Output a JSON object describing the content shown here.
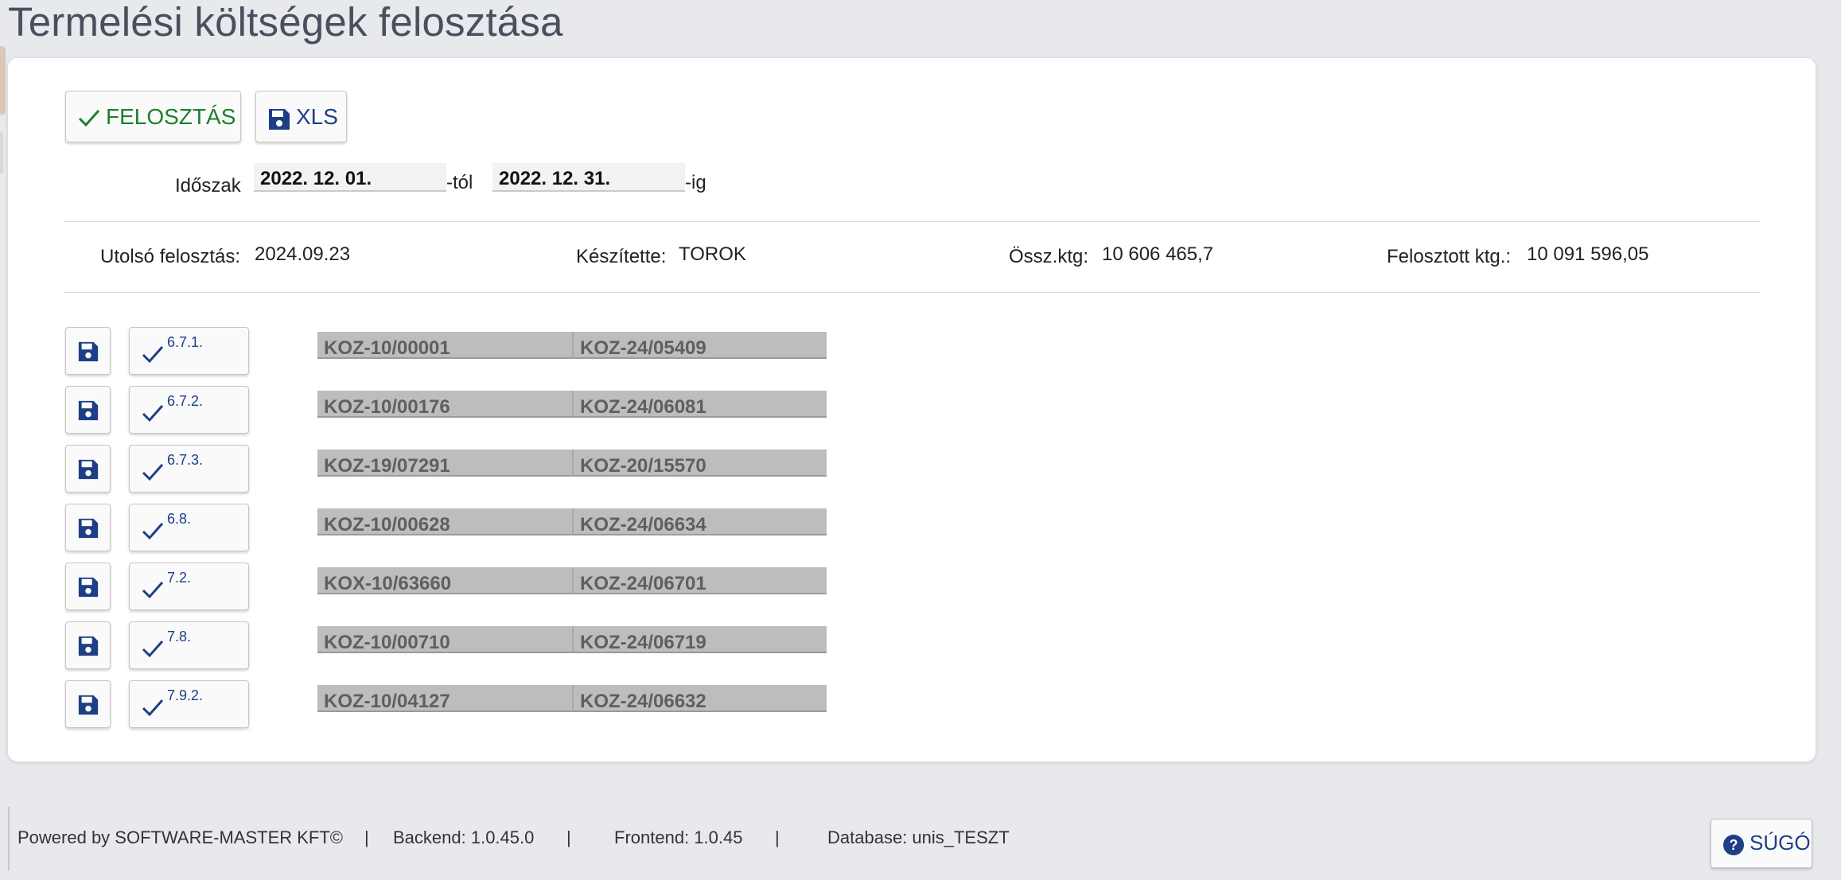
{
  "page": {
    "title": "Termelési költségek felosztása"
  },
  "toolbar": {
    "felosztas_label": "FELOSZTÁS",
    "xls_label": "XLS"
  },
  "period": {
    "label": "Időszak",
    "from_value": "2022. 12. 01.",
    "from_suffix": "-tól",
    "to_value": "2022. 12. 31.",
    "to_suffix": "-ig"
  },
  "summary": {
    "last_label": "Utolsó felosztás:",
    "last_value": "2024.09.23",
    "author_label": "Készítette:",
    "author_value": "TOROK",
    "total_label": "Össz.ktg:",
    "total_value": "10 606 465,7",
    "allocated_label": "Felosztott ktg.:",
    "allocated_value": "10 091 596,05"
  },
  "rows": [
    {
      "label": "6.7.1.",
      "code_a": "KOZ-10/00001",
      "code_b": "KOZ-24/05409"
    },
    {
      "label": "6.7.2.",
      "code_a": "KOZ-10/00176",
      "code_b": "KOZ-24/06081"
    },
    {
      "label": "6.7.3.",
      "code_a": "KOZ-19/07291",
      "code_b": "KOZ-20/15570"
    },
    {
      "label": "6.8.",
      "code_a": "KOZ-10/00628",
      "code_b": "KOZ-24/06634"
    },
    {
      "label": "7.2.",
      "code_a": "KOX-10/63660",
      "code_b": "KOZ-24/06701"
    },
    {
      "label": "7.8.",
      "code_a": "KOZ-10/00710",
      "code_b": "KOZ-24/06719"
    },
    {
      "label": "7.9.2.",
      "code_a": "KOZ-10/04127",
      "code_b": "KOZ-24/06632"
    }
  ],
  "footer": {
    "powered": "Powered by SOFTWARE-MASTER KFT©",
    "sep": "|",
    "backend": "Backend: 1.0.45.0",
    "frontend": "Frontend: 1.0.45",
    "database": "Database: unis_TESZT",
    "help_label": "SÚGÓ"
  },
  "icons": {
    "felosztas": "checkmark-icon",
    "xls": "floppy-disk-icon",
    "row_save": "floppy-disk-icon",
    "row_check": "checkmark-icon",
    "help": "question-circle-icon"
  },
  "colors": {
    "green": "#1d7f2c",
    "navy": "#1c3f87",
    "field_gray": "#bdbdbd"
  }
}
